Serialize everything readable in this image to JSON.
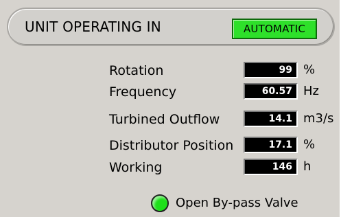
{
  "header": {
    "title": "UNIT OPERATING IN",
    "mode": "AUTOMATIC",
    "mode_color": "#2ee02a"
  },
  "readings": [
    {
      "label": "Rotation",
      "value": "99",
      "unit": "%"
    },
    {
      "label": "Frequency",
      "value": "60.57",
      "unit": "Hz"
    },
    {
      "label": "Turbined Outflow",
      "value": "14.1",
      "unit": "m3/s"
    },
    {
      "label": "Distributor Position",
      "value": "17.1",
      "unit": "%"
    },
    {
      "label": "Working",
      "value": "146",
      "unit": "h"
    }
  ],
  "valve": {
    "label": "Open By-pass Valve",
    "status_color": "#1ee01a"
  }
}
